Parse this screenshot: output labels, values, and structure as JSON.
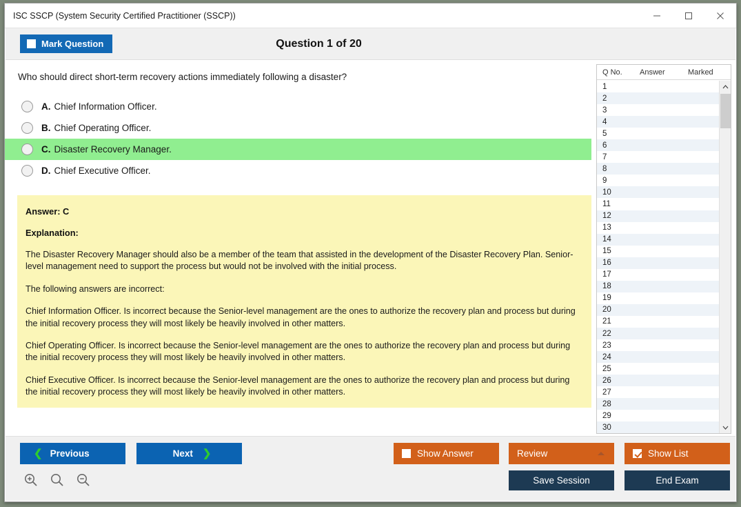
{
  "window": {
    "title": "ISC SSCP (System Security Certified Practitioner (SSCP))",
    "minimize_label": "—",
    "maximize_label": "□",
    "close_label": "✕"
  },
  "header": {
    "mark_question_label": "Mark Question",
    "mark_question_checked": false,
    "question_title": "Question 1 of 20"
  },
  "question": {
    "text": "Who should direct short-term recovery actions immediately following a disaster?",
    "options": [
      {
        "letter": "A.",
        "text": "Chief Information Officer.",
        "correct": false,
        "selected": false
      },
      {
        "letter": "B.",
        "text": "Chief Operating Officer.",
        "correct": false,
        "selected": false
      },
      {
        "letter": "C.",
        "text": "Disaster Recovery Manager.",
        "correct": true,
        "selected": false
      },
      {
        "letter": "D.",
        "text": "Chief Executive Officer.",
        "correct": false,
        "selected": false
      }
    ]
  },
  "explanation": {
    "answer_label": "Answer: C",
    "explanation_label": "Explanation:",
    "paragraphs": [
      "The Disaster Recovery Manager should also be a member of the team that assisted in the development of the Disaster Recovery Plan. Senior-level management need to support the process but would not be involved with the initial process.",
      "The following answers are incorrect:",
      "Chief Information Officer. Is incorrect because the Senior-level management are the ones to authorize the recovery plan and process but during the initial recovery process they will most likely be heavily involved in other matters.",
      "Chief Operating Officer. Is incorrect because the Senior-level management are the ones to authorize the recovery plan and process but during the initial recovery process they will most likely be heavily involved in other matters.",
      "Chief Executive Officer. Is incorrect because the Senior-level management are the ones to authorize the recovery plan and process but during the initial recovery process they will most likely be heavily involved in other matters."
    ]
  },
  "question_list": {
    "columns": [
      "Q No.",
      "Answer",
      "Marked"
    ],
    "rows": [
      {
        "no": "1",
        "answer": "",
        "marked": ""
      },
      {
        "no": "2",
        "answer": "",
        "marked": ""
      },
      {
        "no": "3",
        "answer": "",
        "marked": ""
      },
      {
        "no": "4",
        "answer": "",
        "marked": ""
      },
      {
        "no": "5",
        "answer": "",
        "marked": ""
      },
      {
        "no": "6",
        "answer": "",
        "marked": ""
      },
      {
        "no": "7",
        "answer": "",
        "marked": ""
      },
      {
        "no": "8",
        "answer": "",
        "marked": ""
      },
      {
        "no": "9",
        "answer": "",
        "marked": ""
      },
      {
        "no": "10",
        "answer": "",
        "marked": ""
      },
      {
        "no": "11",
        "answer": "",
        "marked": ""
      },
      {
        "no": "12",
        "answer": "",
        "marked": ""
      },
      {
        "no": "13",
        "answer": "",
        "marked": ""
      },
      {
        "no": "14",
        "answer": "",
        "marked": ""
      },
      {
        "no": "15",
        "answer": "",
        "marked": ""
      },
      {
        "no": "16",
        "answer": "",
        "marked": ""
      },
      {
        "no": "17",
        "answer": "",
        "marked": ""
      },
      {
        "no": "18",
        "answer": "",
        "marked": ""
      },
      {
        "no": "19",
        "answer": "",
        "marked": ""
      },
      {
        "no": "20",
        "answer": "",
        "marked": ""
      },
      {
        "no": "21",
        "answer": "",
        "marked": ""
      },
      {
        "no": "22",
        "answer": "",
        "marked": ""
      },
      {
        "no": "23",
        "answer": "",
        "marked": ""
      },
      {
        "no": "24",
        "answer": "",
        "marked": ""
      },
      {
        "no": "25",
        "answer": "",
        "marked": ""
      },
      {
        "no": "26",
        "answer": "",
        "marked": ""
      },
      {
        "no": "27",
        "answer": "",
        "marked": ""
      },
      {
        "no": "28",
        "answer": "",
        "marked": ""
      },
      {
        "no": "29",
        "answer": "",
        "marked": ""
      },
      {
        "no": "30",
        "answer": "",
        "marked": ""
      }
    ],
    "scroll_up_label": "ⱏ",
    "scroll_down_label": "ⱟ"
  },
  "footer": {
    "previous_label": "Previous",
    "next_label": "Next",
    "prev_chevron": "❮",
    "next_chevron": "❯",
    "show_answer_label": "Show Answer",
    "show_answer_checked": false,
    "review_label": "Review",
    "show_list_label": "Show List",
    "show_list_checked": true,
    "save_session_label": "Save Session",
    "end_exam_label": "End Exam"
  },
  "colors": {
    "blue": "#0b63b2",
    "orange": "#d2601a",
    "navy": "#1d3a53",
    "correct_green": "#90ee90",
    "explanation_yellow": "#fbf6b8",
    "chevron_green": "#2ecc2e"
  }
}
